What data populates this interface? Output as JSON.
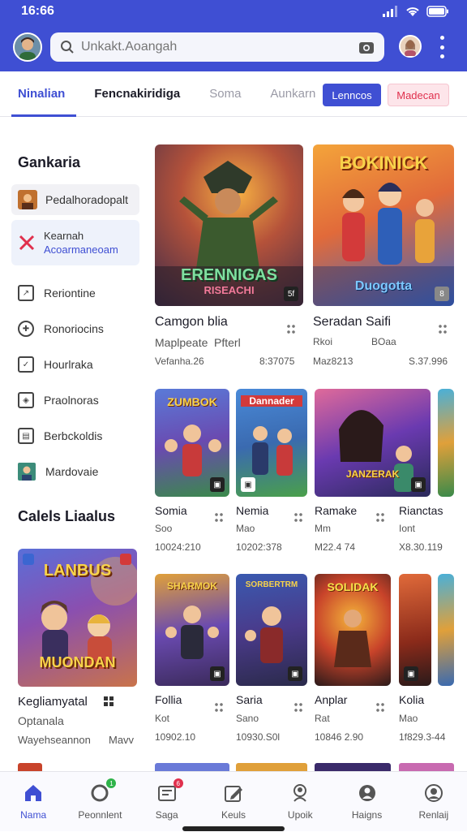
{
  "status": {
    "time": "16:66"
  },
  "header": {
    "search_placeholder": "Unkakt.Aoangah"
  },
  "tabs": [
    {
      "label": "Ninalian"
    },
    {
      "label": "Fencnakiridiga"
    },
    {
      "label": "Soma"
    },
    {
      "label": "Aunkarn"
    }
  ],
  "actions": {
    "primary": "Lenncos",
    "secondary": "Madecan"
  },
  "sidebar": {
    "title": "Gankaria",
    "items": [
      {
        "label": "Pedalhoradopalt"
      },
      {
        "label": "Kearnah",
        "sub": "Acoarmaneoam"
      },
      {
        "label": "Reriontine"
      },
      {
        "label": "Ronoriocins"
      },
      {
        "label": "Hourlraka"
      },
      {
        "label": "Praolnoras"
      },
      {
        "label": "Berbckoldis"
      },
      {
        "label": "Mardovaie"
      }
    ],
    "section2_title": "Calels Liaalus",
    "promo": {
      "banner_top": "LANBUS",
      "banner_bottom": "MUONDAN",
      "title": "Kegliamyatal",
      "line2": "Optanala",
      "line3": "Wayehseannon",
      "line3_right": "Mavv"
    }
  },
  "featured": [
    {
      "art_text": "ERENNIGAS",
      "art_sub": "RISEACHI",
      "badge": "5f",
      "title": "Camgon blia",
      "meta1": "Maplpeate",
      "meta1_right": "Pfterl",
      "meta2": "Vefanha.26",
      "meta2_right": "8:37075"
    },
    {
      "art_text": "BOKINICK",
      "art_sub": "Duogotta",
      "badge": "8",
      "title": "Seradan Saifi",
      "meta1": "Rkoi",
      "meta1_right": "BOaa",
      "meta2": "Maz8213",
      "meta2_right": "S.37.996"
    }
  ],
  "row1": [
    {
      "art": "ZUMBOK",
      "title": "Somia",
      "meta1": "Soo",
      "meta2": "10024:210"
    },
    {
      "art": "Dannader",
      "title": "Nemia",
      "meta1": "Mao",
      "meta2": "10202:378"
    },
    {
      "art": "JANZERAK",
      "title": "Ramake",
      "meta1": "Mm",
      "meta2": "M22.4 74"
    },
    {
      "art": "",
      "title": "Rianctas",
      "meta1": "Iont",
      "meta2": "X8.30.119"
    }
  ],
  "row2": [
    {
      "art": "SHARMOK",
      "title": "Follia",
      "meta1": "Kot",
      "meta2": "10902.10"
    },
    {
      "art": "SORBERTRM",
      "title": "Saria",
      "meta1": "Sano",
      "meta2": "10930.S0l"
    },
    {
      "art": "SOLIDAK",
      "title": "Anplar",
      "meta1": "Rat",
      "meta2": "10846 2.90"
    },
    {
      "art": "",
      "title": "Kolia",
      "meta1": "Mao",
      "meta2": "1f829.3-44"
    }
  ],
  "bottom_nav": [
    {
      "label": "Nama",
      "icon": "home-icon",
      "badge": ""
    },
    {
      "label": "Peonnlent",
      "icon": "ring-icon",
      "badge": "1"
    },
    {
      "label": "Saga",
      "icon": "library-icon",
      "badge": "6"
    },
    {
      "label": "Keuls",
      "icon": "edit-icon",
      "badge": ""
    },
    {
      "label": "Upoik",
      "icon": "profile-icon",
      "badge": ""
    },
    {
      "label": "Haigns",
      "icon": "person-icon",
      "badge": ""
    },
    {
      "label": "Renlaij",
      "icon": "account-icon",
      "badge": ""
    }
  ],
  "colors": {
    "accent": "#3f4fd3",
    "danger": "#e0304d"
  }
}
